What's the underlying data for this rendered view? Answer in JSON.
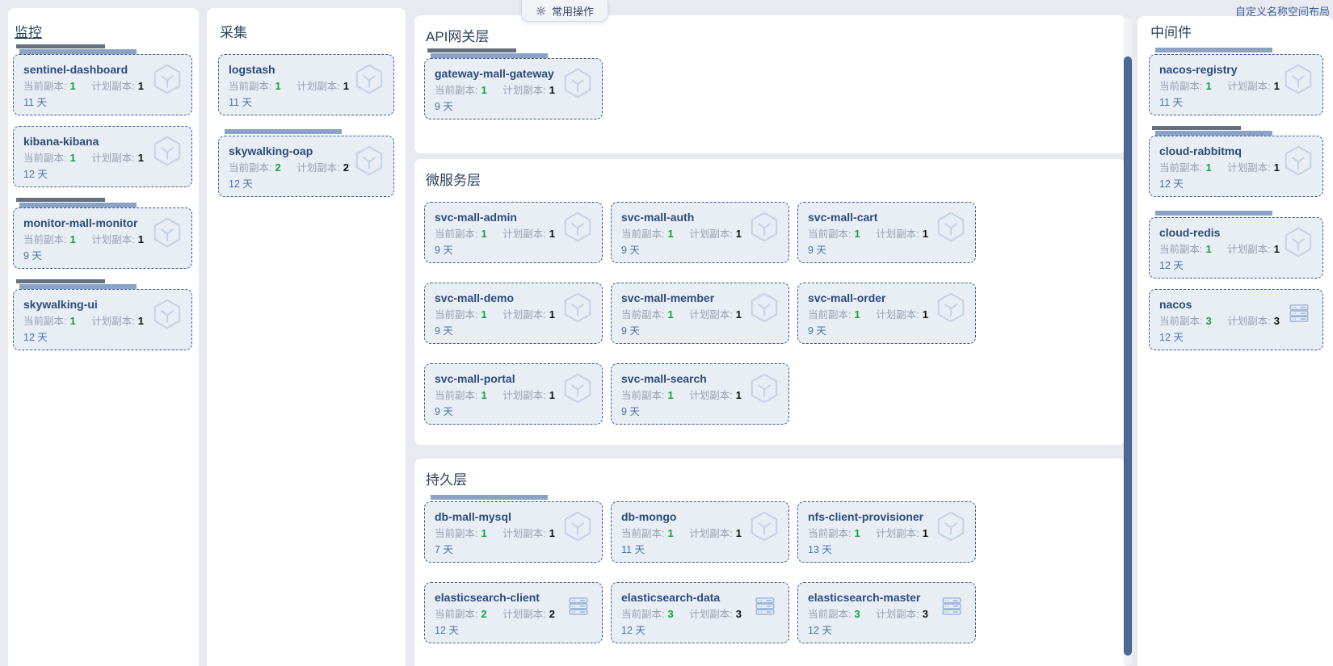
{
  "header": {
    "operations_label": "常用操作",
    "customize_link": "自定义名称空间布局"
  },
  "labels": {
    "current": "当前副本:",
    "desired": "计划副本:"
  },
  "colors": {
    "bg": "#e8eaef",
    "panel": "#ffffff",
    "card-bg": "#e9edf4",
    "card-border": "#3c5d91",
    "name": "#2c4c79",
    "label": "#9aa3b2",
    "num": "#111111",
    "green": "#17a33a",
    "day": "#4a74ae",
    "title": "#2b4059",
    "bar-dark": "#666f7e",
    "bar-blue": "#8aa2c6",
    "link": "#3c5f9a",
    "scroll-thumb": "#4b6b97",
    "btn-bg": "#f1f3f7",
    "btn-border": "#d3dae6",
    "btn-text": "#3b4964",
    "icon-cube": "#c7d2e3",
    "icon-server": "#9fb7dd"
  },
  "groups": [
    {
      "title": "监控",
      "underline": true,
      "cards": [
        {
          "name": "sentinel-dashboard",
          "current": "1",
          "desired": "1",
          "age": "11 天",
          "icon": "deployment-cube-icon",
          "bars": "both"
        },
        {
          "name": "kibana-kibana",
          "current": "1",
          "desired": "1",
          "age": "12 天",
          "icon": "deployment-cube-icon",
          "bars": "none"
        },
        {
          "name": "monitor-mall-monitor",
          "current": "1",
          "desired": "1",
          "age": "9 天",
          "icon": "deployment-cube-icon",
          "bars": "both"
        },
        {
          "name": "skywalking-ui",
          "current": "1",
          "desired": "1",
          "age": "12 天",
          "icon": "deployment-cube-icon",
          "bars": "both"
        }
      ]
    },
    {
      "title": "采集",
      "underline": false,
      "cards": [
        {
          "name": "logstash",
          "current": "1",
          "desired": "1",
          "age": "11 天",
          "icon": "deployment-cube-icon",
          "bars": "none"
        },
        {
          "name": "skywalking-oap",
          "current": "2",
          "desired": "2",
          "age": "12 天",
          "icon": "deployment-cube-icon",
          "bars": "blue"
        }
      ]
    },
    {
      "title": "API网关层",
      "underline": false,
      "cards": [
        {
          "name": "gateway-mall-gateway",
          "current": "1",
          "desired": "1",
          "age": "9 天",
          "icon": "deployment-cube-icon",
          "bars": "both"
        }
      ]
    },
    {
      "title": "微服务层",
      "underline": false,
      "cards": [
        {
          "name": "svc-mall-admin",
          "current": "1",
          "desired": "1",
          "age": "9 天",
          "icon": "deployment-cube-icon",
          "bars": "none"
        },
        {
          "name": "svc-mall-auth",
          "current": "1",
          "desired": "1",
          "age": "9 天",
          "icon": "deployment-cube-icon",
          "bars": "none"
        },
        {
          "name": "svc-mall-cart",
          "current": "1",
          "desired": "1",
          "age": "9 天",
          "icon": "deployment-cube-icon",
          "bars": "none"
        },
        {
          "name": "svc-mall-demo",
          "current": "1",
          "desired": "1",
          "age": "9 天",
          "icon": "deployment-cube-icon",
          "bars": "none"
        },
        {
          "name": "svc-mall-member",
          "current": "1",
          "desired": "1",
          "age": "9 天",
          "icon": "deployment-cube-icon",
          "bars": "none"
        },
        {
          "name": "svc-mall-order",
          "current": "1",
          "desired": "1",
          "age": "9 天",
          "icon": "deployment-cube-icon",
          "bars": "none"
        },
        {
          "name": "svc-mall-portal",
          "current": "1",
          "desired": "1",
          "age": "9 天",
          "icon": "deployment-cube-icon",
          "bars": "none"
        },
        {
          "name": "svc-mall-search",
          "current": "1",
          "desired": "1",
          "age": "9 天",
          "icon": "deployment-cube-icon",
          "bars": "none"
        }
      ]
    },
    {
      "title": "持久层",
      "underline": false,
      "cards": [
        {
          "name": "db-mall-mysql",
          "current": "1",
          "desired": "1",
          "age": "7 天",
          "icon": "deployment-cube-icon",
          "bars": "blue"
        },
        {
          "name": "db-mongo",
          "current": "1",
          "desired": "1",
          "age": "11 天",
          "icon": "deployment-cube-icon",
          "bars": "none"
        },
        {
          "name": "nfs-client-provisioner",
          "current": "1",
          "desired": "1",
          "age": "13 天",
          "icon": "deployment-cube-icon",
          "bars": "none"
        },
        {
          "name": "elasticsearch-client",
          "current": "2",
          "desired": "2",
          "age": "12 天",
          "icon": "statefulset-server-icon",
          "bars": "none"
        },
        {
          "name": "elasticsearch-data",
          "current": "3",
          "desired": "3",
          "age": "12 天",
          "icon": "statefulset-server-icon",
          "bars": "none"
        },
        {
          "name": "elasticsearch-master",
          "current": "3",
          "desired": "3",
          "age": "12 天",
          "icon": "statefulset-server-icon",
          "bars": "none"
        }
      ]
    },
    {
      "title": "中间件",
      "underline": false,
      "cards": [
        {
          "name": "nacos-registry",
          "current": "1",
          "desired": "1",
          "age": "11 天",
          "icon": "deployment-cube-icon",
          "bars": "blue"
        },
        {
          "name": "cloud-rabbitmq",
          "current": "1",
          "desired": "1",
          "age": "12 天",
          "icon": "deployment-cube-icon",
          "bars": "both"
        },
        {
          "name": "cloud-redis",
          "current": "1",
          "desired": "1",
          "age": "12 天",
          "icon": "deployment-cube-icon",
          "bars": "blue"
        },
        {
          "name": "nacos",
          "current": "3",
          "desired": "3",
          "age": "12 天",
          "icon": "statefulset-server-icon",
          "bars": "none"
        }
      ]
    }
  ]
}
